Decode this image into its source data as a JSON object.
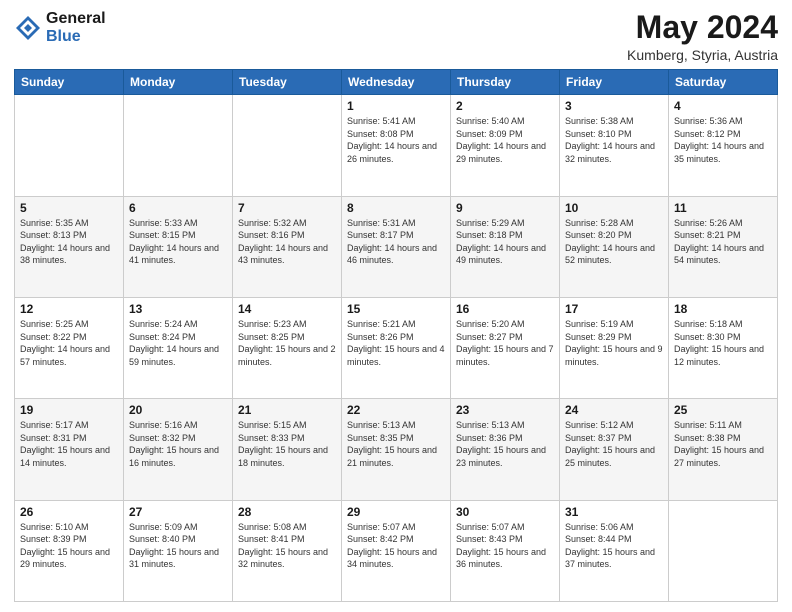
{
  "logo": {
    "line1": "General",
    "line2": "Blue"
  },
  "title": "May 2024",
  "subtitle": "Kumberg, Styria, Austria",
  "days_of_week": [
    "Sunday",
    "Monday",
    "Tuesday",
    "Wednesday",
    "Thursday",
    "Friday",
    "Saturday"
  ],
  "weeks": [
    [
      {
        "day": "",
        "info": ""
      },
      {
        "day": "",
        "info": ""
      },
      {
        "day": "",
        "info": ""
      },
      {
        "day": "1",
        "info": "Sunrise: 5:41 AM\nSunset: 8:08 PM\nDaylight: 14 hours and 26 minutes."
      },
      {
        "day": "2",
        "info": "Sunrise: 5:40 AM\nSunset: 8:09 PM\nDaylight: 14 hours and 29 minutes."
      },
      {
        "day": "3",
        "info": "Sunrise: 5:38 AM\nSunset: 8:10 PM\nDaylight: 14 hours and 32 minutes."
      },
      {
        "day": "4",
        "info": "Sunrise: 5:36 AM\nSunset: 8:12 PM\nDaylight: 14 hours and 35 minutes."
      }
    ],
    [
      {
        "day": "5",
        "info": "Sunrise: 5:35 AM\nSunset: 8:13 PM\nDaylight: 14 hours and 38 minutes."
      },
      {
        "day": "6",
        "info": "Sunrise: 5:33 AM\nSunset: 8:15 PM\nDaylight: 14 hours and 41 minutes."
      },
      {
        "day": "7",
        "info": "Sunrise: 5:32 AM\nSunset: 8:16 PM\nDaylight: 14 hours and 43 minutes."
      },
      {
        "day": "8",
        "info": "Sunrise: 5:31 AM\nSunset: 8:17 PM\nDaylight: 14 hours and 46 minutes."
      },
      {
        "day": "9",
        "info": "Sunrise: 5:29 AM\nSunset: 8:18 PM\nDaylight: 14 hours and 49 minutes."
      },
      {
        "day": "10",
        "info": "Sunrise: 5:28 AM\nSunset: 8:20 PM\nDaylight: 14 hours and 52 minutes."
      },
      {
        "day": "11",
        "info": "Sunrise: 5:26 AM\nSunset: 8:21 PM\nDaylight: 14 hours and 54 minutes."
      }
    ],
    [
      {
        "day": "12",
        "info": "Sunrise: 5:25 AM\nSunset: 8:22 PM\nDaylight: 14 hours and 57 minutes."
      },
      {
        "day": "13",
        "info": "Sunrise: 5:24 AM\nSunset: 8:24 PM\nDaylight: 14 hours and 59 minutes."
      },
      {
        "day": "14",
        "info": "Sunrise: 5:23 AM\nSunset: 8:25 PM\nDaylight: 15 hours and 2 minutes."
      },
      {
        "day": "15",
        "info": "Sunrise: 5:21 AM\nSunset: 8:26 PM\nDaylight: 15 hours and 4 minutes."
      },
      {
        "day": "16",
        "info": "Sunrise: 5:20 AM\nSunset: 8:27 PM\nDaylight: 15 hours and 7 minutes."
      },
      {
        "day": "17",
        "info": "Sunrise: 5:19 AM\nSunset: 8:29 PM\nDaylight: 15 hours and 9 minutes."
      },
      {
        "day": "18",
        "info": "Sunrise: 5:18 AM\nSunset: 8:30 PM\nDaylight: 15 hours and 12 minutes."
      }
    ],
    [
      {
        "day": "19",
        "info": "Sunrise: 5:17 AM\nSunset: 8:31 PM\nDaylight: 15 hours and 14 minutes."
      },
      {
        "day": "20",
        "info": "Sunrise: 5:16 AM\nSunset: 8:32 PM\nDaylight: 15 hours and 16 minutes."
      },
      {
        "day": "21",
        "info": "Sunrise: 5:15 AM\nSunset: 8:33 PM\nDaylight: 15 hours and 18 minutes."
      },
      {
        "day": "22",
        "info": "Sunrise: 5:13 AM\nSunset: 8:35 PM\nDaylight: 15 hours and 21 minutes."
      },
      {
        "day": "23",
        "info": "Sunrise: 5:13 AM\nSunset: 8:36 PM\nDaylight: 15 hours and 23 minutes."
      },
      {
        "day": "24",
        "info": "Sunrise: 5:12 AM\nSunset: 8:37 PM\nDaylight: 15 hours and 25 minutes."
      },
      {
        "day": "25",
        "info": "Sunrise: 5:11 AM\nSunset: 8:38 PM\nDaylight: 15 hours and 27 minutes."
      }
    ],
    [
      {
        "day": "26",
        "info": "Sunrise: 5:10 AM\nSunset: 8:39 PM\nDaylight: 15 hours and 29 minutes."
      },
      {
        "day": "27",
        "info": "Sunrise: 5:09 AM\nSunset: 8:40 PM\nDaylight: 15 hours and 31 minutes."
      },
      {
        "day": "28",
        "info": "Sunrise: 5:08 AM\nSunset: 8:41 PM\nDaylight: 15 hours and 32 minutes."
      },
      {
        "day": "29",
        "info": "Sunrise: 5:07 AM\nSunset: 8:42 PM\nDaylight: 15 hours and 34 minutes."
      },
      {
        "day": "30",
        "info": "Sunrise: 5:07 AM\nSunset: 8:43 PM\nDaylight: 15 hours and 36 minutes."
      },
      {
        "day": "31",
        "info": "Sunrise: 5:06 AM\nSunset: 8:44 PM\nDaylight: 15 hours and 37 minutes."
      },
      {
        "day": "",
        "info": ""
      }
    ]
  ]
}
